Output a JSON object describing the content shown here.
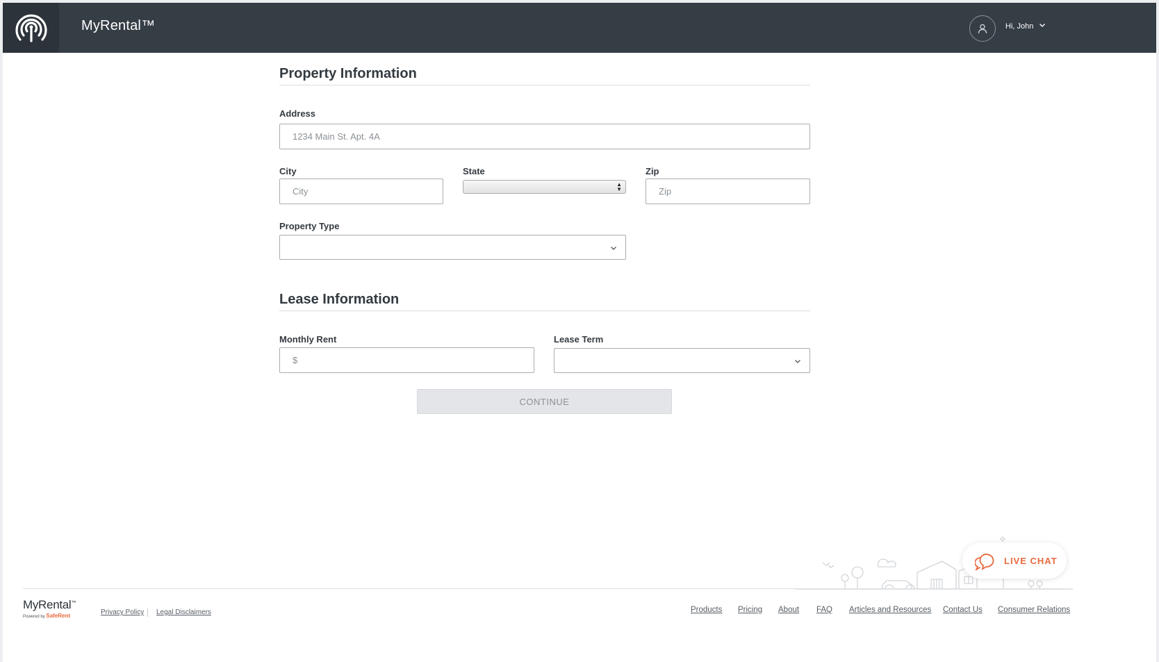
{
  "header": {
    "app_title": "MyRental™",
    "user_greeting": "Hi, John"
  },
  "property_section": {
    "title": "Property Information",
    "address": {
      "label": "Address",
      "placeholder": "1234 Main St. Apt. 4A",
      "value": ""
    },
    "city": {
      "label": "City",
      "placeholder": "City",
      "value": ""
    },
    "state": {
      "label": "State",
      "selected": ""
    },
    "zip": {
      "label": "Zip",
      "placeholder": "Zip",
      "value": ""
    },
    "property_type": {
      "label": "Property Type",
      "selected": ""
    }
  },
  "lease_section": {
    "title": "Lease Information",
    "monthly_rent": {
      "label": "Monthly Rent",
      "placeholder": "$",
      "value": ""
    },
    "lease_term": {
      "label": "Lease Term",
      "selected": ""
    }
  },
  "continue_label": "CONTINUE",
  "live_chat_label": "LIVE CHAT",
  "footer": {
    "brand": "MyRental",
    "brand_tm": "™",
    "powered_by": "Powered by",
    "powered_brand": "SafeRent",
    "legal_links": [
      "Privacy Policy",
      "Legal Disclaimers"
    ],
    "nav_links": [
      "Products",
      "Pricing",
      "About",
      "FAQ",
      "Articles and Resources",
      "Contact Us",
      "Consumer Relations"
    ]
  },
  "colors": {
    "header_bg": "#353d45",
    "accent_orange": "#e8693d",
    "disabled_button": "#e3e5e8"
  },
  "icons": [
    "broadcast-logo-icon",
    "user-icon",
    "chevron-down-icon",
    "chat-bubble-icon"
  ]
}
